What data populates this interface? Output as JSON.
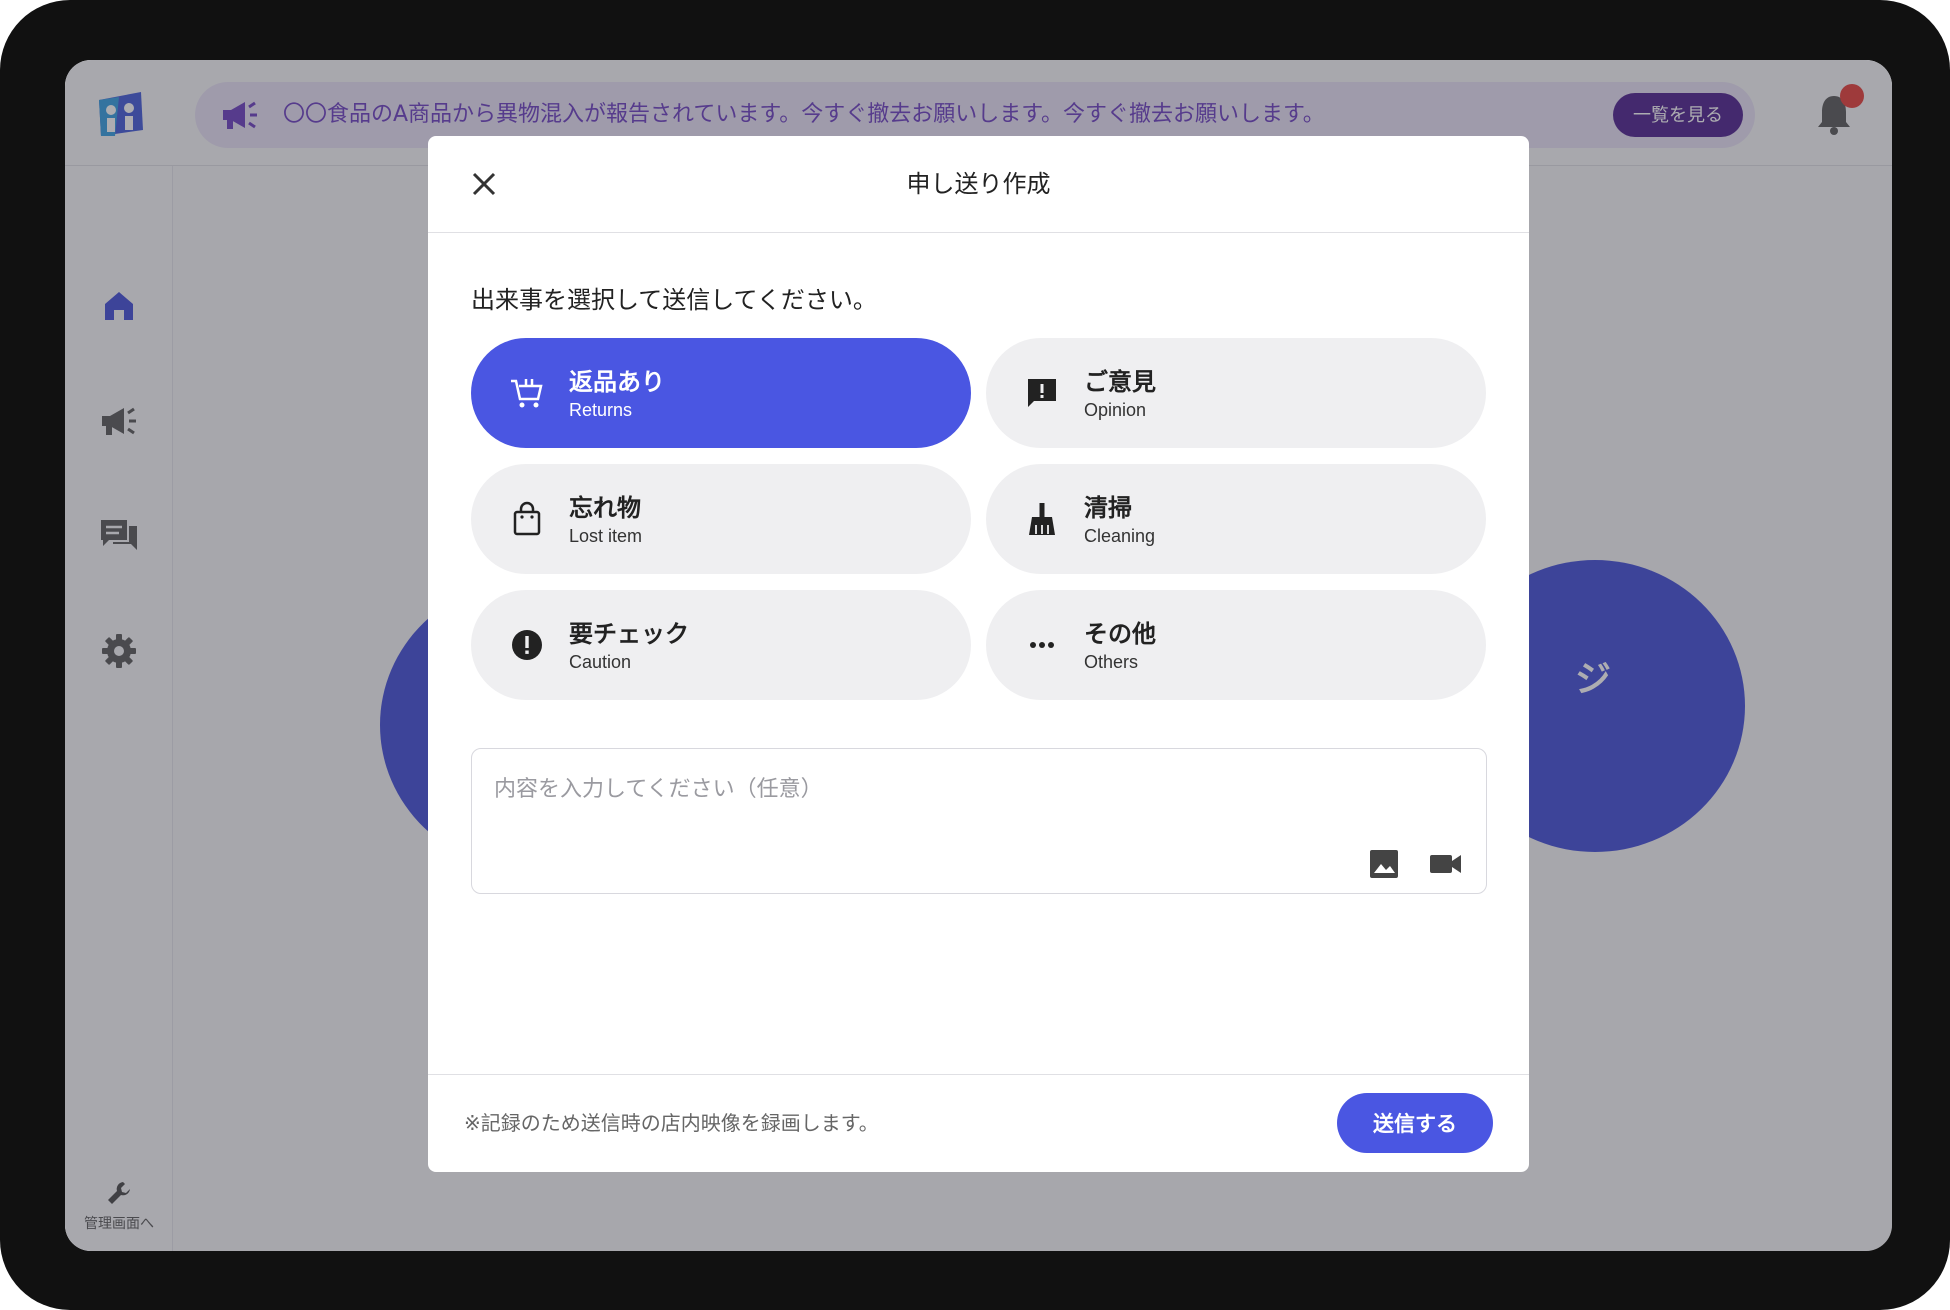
{
  "header": {
    "announcement": "〇〇食品のA商品から異物混入が報告されています。今すぐ撤去お願いします。今すぐ撤去お願いします。",
    "view_all_label": "一覧を見る"
  },
  "sidebar": {
    "admin_label": "管理画面へ"
  },
  "background": {
    "right_fragment": "ジ"
  },
  "modal": {
    "title": "申し送り作成",
    "instruction": "出来事を選択して送信してください。",
    "categories": [
      {
        "jp": "返品あり",
        "en": "Returns",
        "icon": "cart-icon",
        "selected": true
      },
      {
        "jp": "ご意見",
        "en": "Opinion",
        "icon": "feedback-icon",
        "selected": false
      },
      {
        "jp": "忘れ物",
        "en": "Lost item",
        "icon": "bag-icon",
        "selected": false
      },
      {
        "jp": "清掃",
        "en": "Cleaning",
        "icon": "broom-icon",
        "selected": false
      },
      {
        "jp": "要チェック",
        "en": "Caution",
        "icon": "alert-icon",
        "selected": false
      },
      {
        "jp": "その他",
        "en": "Others",
        "icon": "more-icon",
        "selected": false
      }
    ],
    "content_placeholder": "内容を入力してください（任意）",
    "footer_note": "※記録のため送信時の店内映像を録画します。",
    "send_label": "送信する"
  },
  "colors": {
    "accent": "#4a56e2",
    "announce_bg": "#e7e1f4",
    "announce_text": "#6a3cc0",
    "announce_button": "#4b1d8c",
    "notification_dot": "#e53935"
  }
}
